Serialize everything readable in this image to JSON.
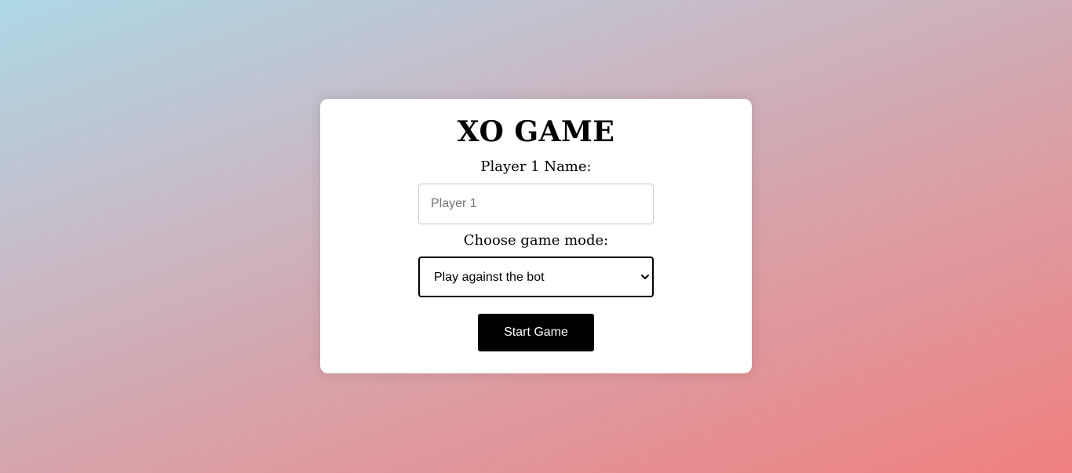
{
  "card": {
    "title": "XO GAME",
    "player_label": "Player 1 Name:",
    "player_input": {
      "value": "",
      "placeholder": "Player 1"
    },
    "mode_label": "Choose game mode:",
    "mode_select": {
      "selected": "Play against the bot"
    },
    "start_button_label": "Start Game"
  },
  "icons": {
    "select_arrow": "chevron-down-icon"
  },
  "colors": {
    "gradient_start": "#add8e6",
    "gradient_end": "#f08080",
    "button_bg": "#000000",
    "button_text": "#ffffff",
    "card_bg": "#ffffff"
  }
}
